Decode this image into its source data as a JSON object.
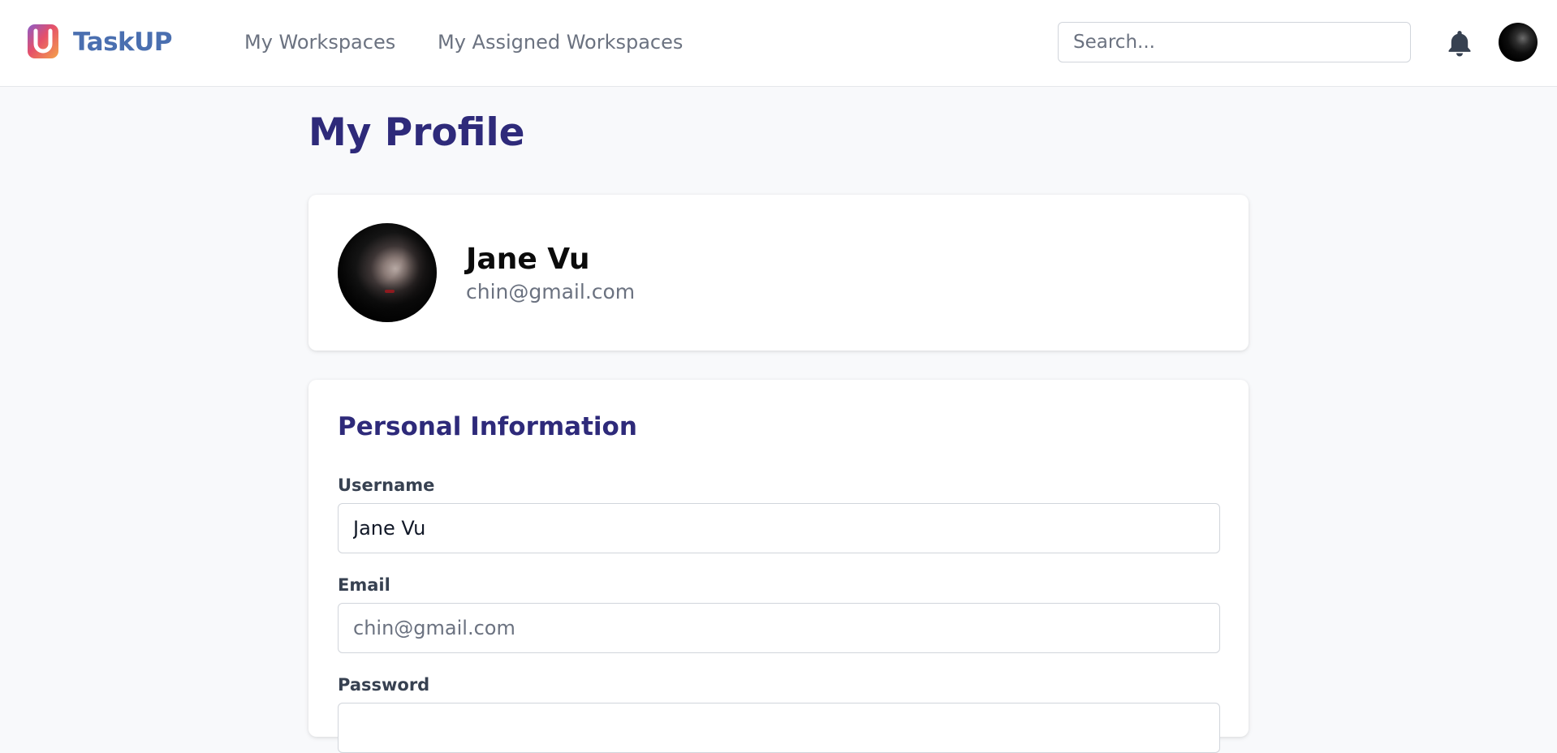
{
  "header": {
    "brand": "TaskUP",
    "nav": [
      "My Workspaces",
      "My Assigned Workspaces"
    ],
    "search_placeholder": "Search...",
    "icons": [
      "taskup-logo-icon",
      "bell-icon"
    ]
  },
  "page": {
    "title": "My Profile"
  },
  "profile": {
    "name": "Jane Vu",
    "email": "chin@gmail.com"
  },
  "personal_info": {
    "title": "Personal Information",
    "username_label": "Username",
    "username_value": "Jane Vu",
    "email_label": "Email",
    "email_value": "chin@gmail.com",
    "password_label": "Password"
  },
  "colors": {
    "title": "#2e2a7a",
    "brand": "#4a6fb0",
    "muted": "#6b7280",
    "background": "#f8f9fb"
  }
}
